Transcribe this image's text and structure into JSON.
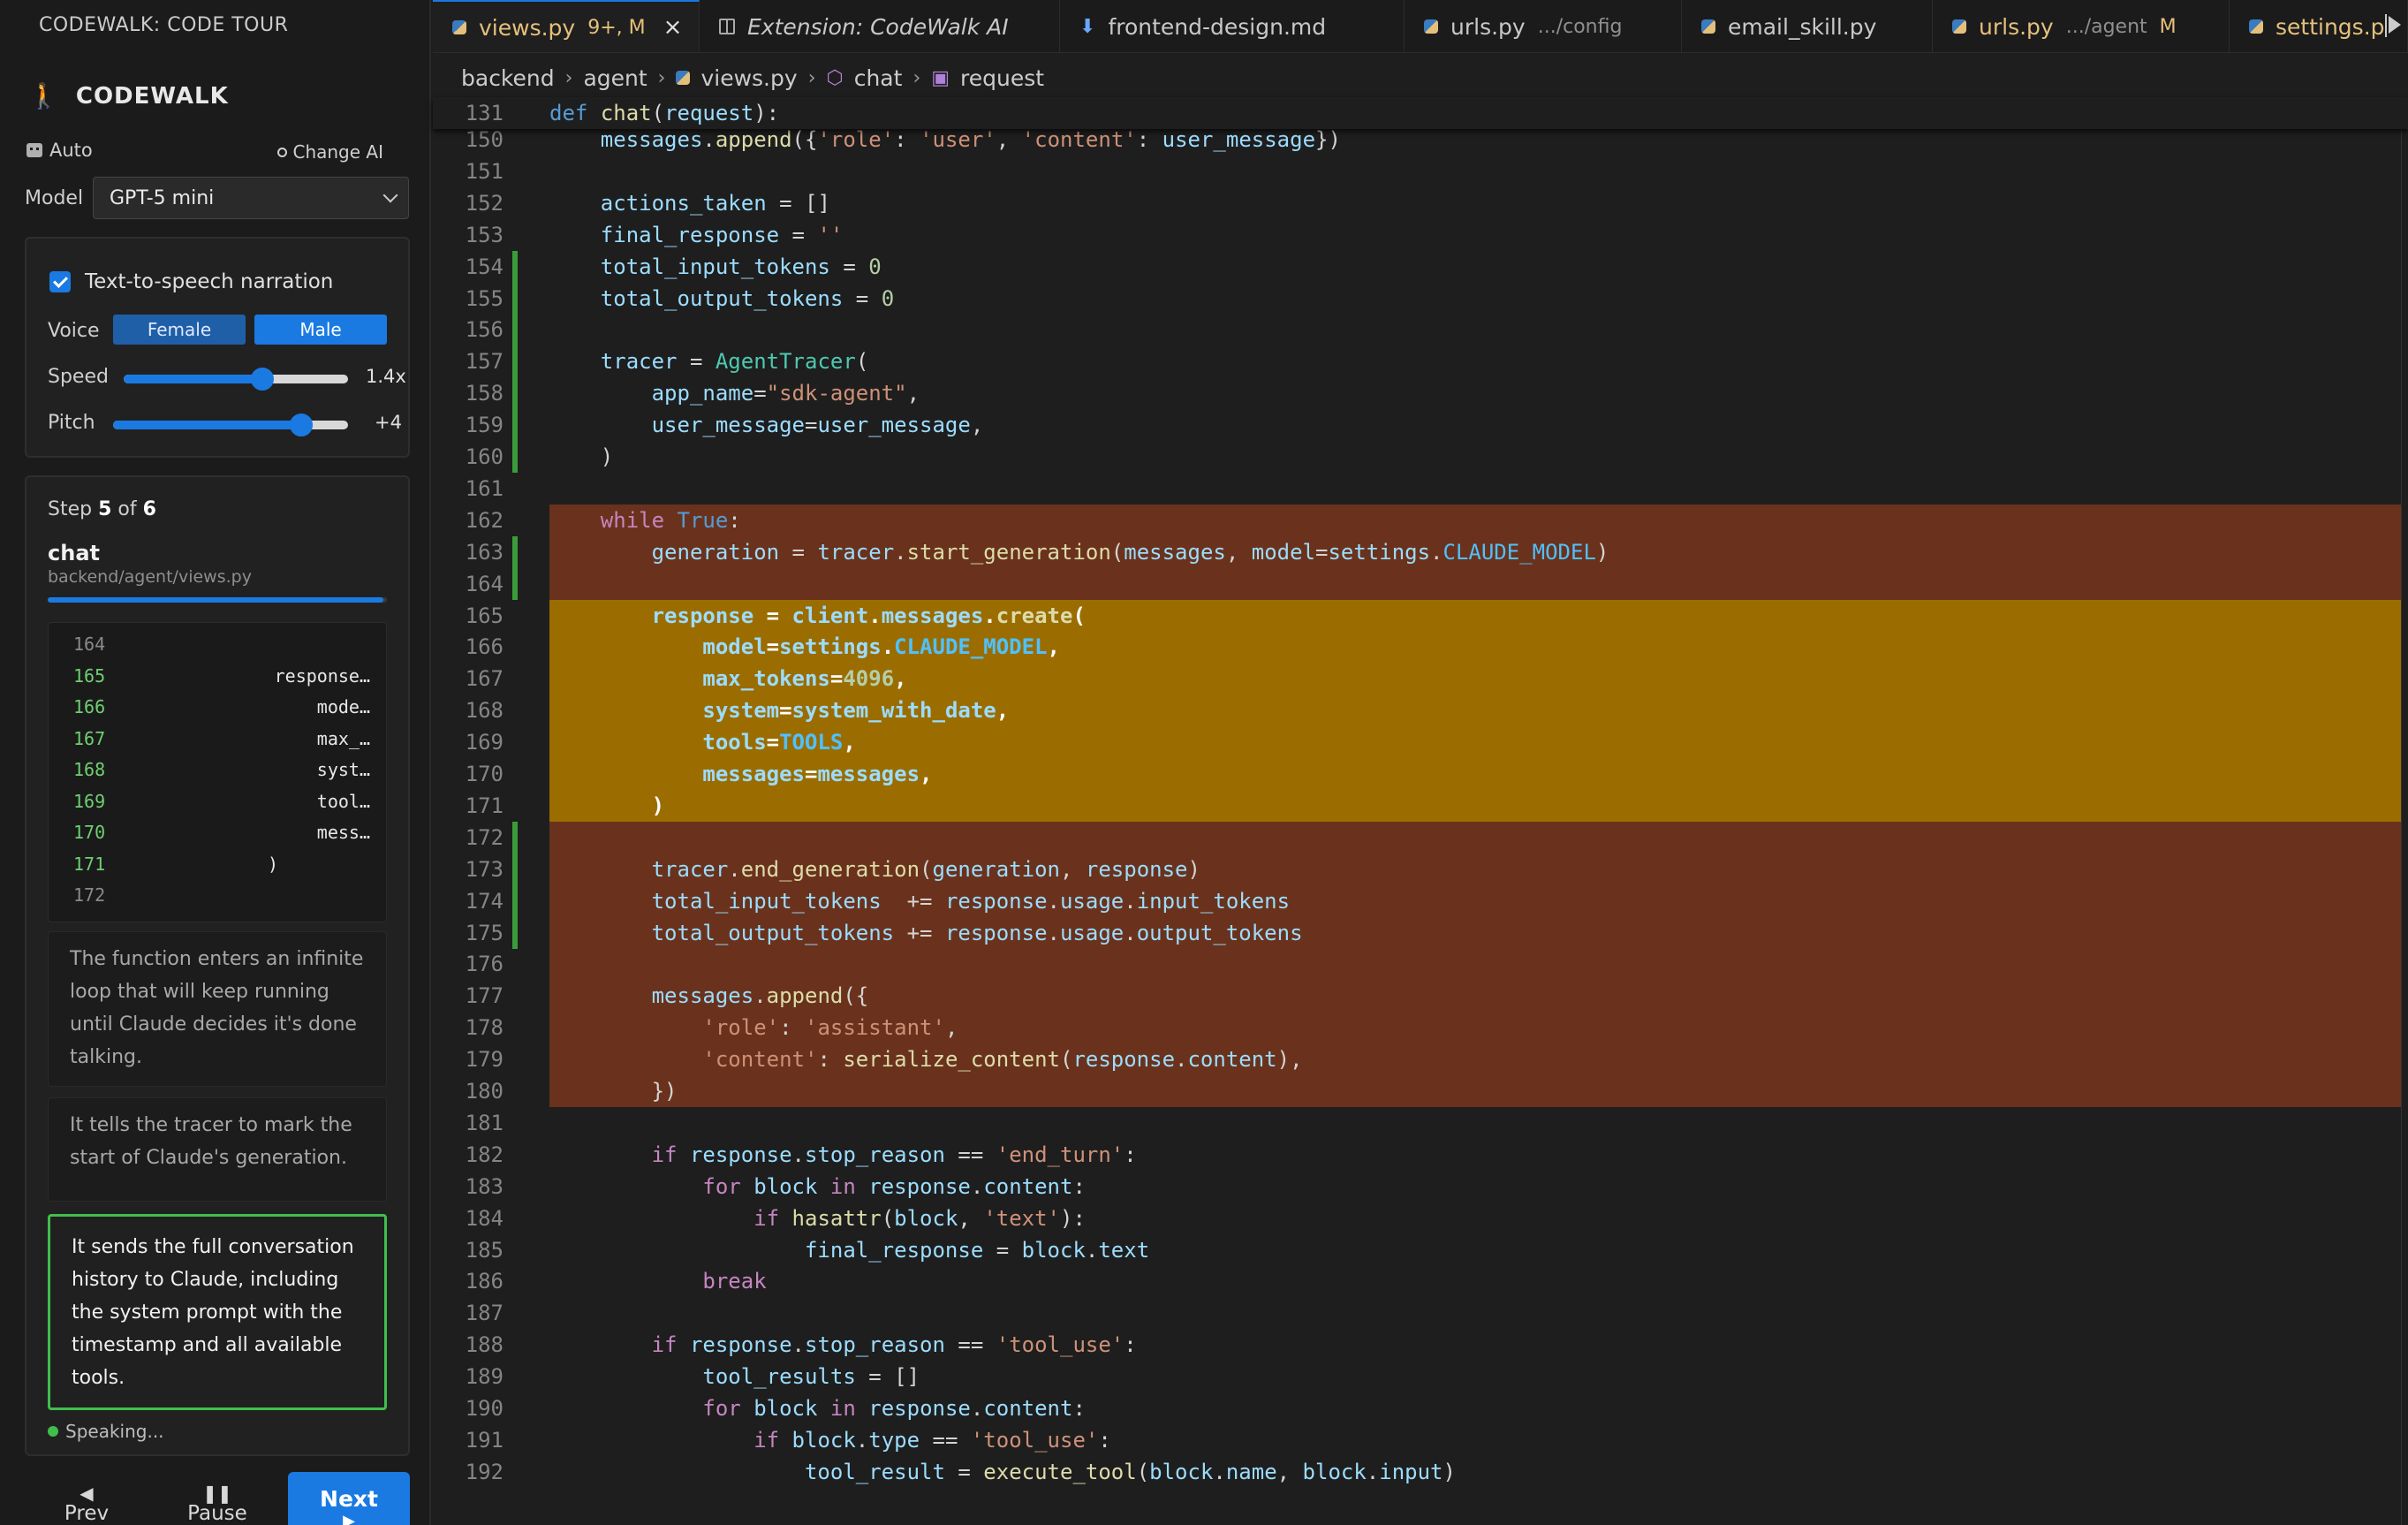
{
  "sidebar": {
    "title": "CODEWALK: CODE TOUR",
    "brand": "CODEWALK",
    "auto_label": "Auto",
    "change_ai_label": "Change AI",
    "model_label": "Model",
    "model_value": "GPT-5 mini",
    "tts_label": "Text-to-speech narration",
    "voice_label": "Voice",
    "voice_female": "Female",
    "voice_male": "Male",
    "speed_label": "Speed",
    "speed_value": "1.4x",
    "speed_fraction": 0.62,
    "pitch_label": "Pitch",
    "pitch_value": "+4",
    "pitch_fraction": 0.8,
    "step_prefix": "Step ",
    "step_current": "5",
    "step_of": " of ",
    "step_total": "6",
    "function_name": "chat",
    "file_path": "backend/agent/views.py",
    "progress_fraction": 0.99,
    "mini_lines": [
      {
        "num": "164",
        "text": ""
      },
      {
        "num": "165",
        "text": "response…"
      },
      {
        "num": "166",
        "text": "mode…"
      },
      {
        "num": "167",
        "text": "max_…"
      },
      {
        "num": "168",
        "text": "syst…"
      },
      {
        "num": "169",
        "text": "tool…"
      },
      {
        "num": "170",
        "text": "mess…"
      },
      {
        "num": "171",
        "text": ")"
      },
      {
        "num": "172",
        "text": ""
      }
    ],
    "narration_1": "The function enters an infinite loop that will keep running until Claude decides it's done talking.",
    "narration_2": "It tells the tracer to mark the start of Claude's generation.",
    "narration_3": "It sends the full conversation history to Claude, including the system prompt with the timestamp and all available tools.",
    "speaking": "Speaking...",
    "prev_label": "Prev",
    "pause_label": "Pause",
    "next_label": "Next"
  },
  "tabs": [
    {
      "label": "views.py",
      "meta": "9+, M",
      "active": true,
      "icon": "python-icon"
    },
    {
      "label": "Extension: CodeWalk AI",
      "meta": "",
      "active": false,
      "icon": "extension-icon"
    },
    {
      "label": "frontend-design.md",
      "meta": "",
      "active": false,
      "icon": "markdown-icon"
    },
    {
      "label": "urls.py",
      "meta": ".../config",
      "active": false,
      "icon": "python-icon"
    },
    {
      "label": "email_skill.py",
      "meta": "",
      "active": false,
      "icon": "python-icon"
    },
    {
      "label": "urls.py",
      "meta": ".../agent",
      "mod": "M",
      "active": false,
      "icon": "python-icon"
    },
    {
      "label": "settings.p",
      "meta": "",
      "active": false,
      "icon": "python-icon"
    }
  ],
  "breadcrumb": {
    "c1": "backend",
    "c2": "agent",
    "c3": "views.py",
    "c4": "chat",
    "c5": "request"
  },
  "editor": {
    "sticky_num": "131",
    "sticky_text": "def chat(request):",
    "lines": [
      {
        "n": "150",
        "t": "    messages.append({'role': 'user', 'content': user_message})",
        "hl": "",
        "mod": false
      },
      {
        "n": "151",
        "t": "",
        "hl": "",
        "mod": false
      },
      {
        "n": "152",
        "t": "    actions_taken = []",
        "hl": "",
        "mod": false
      },
      {
        "n": "153",
        "t": "    final_response = ''",
        "hl": "",
        "mod": false
      },
      {
        "n": "154",
        "t": "    total_input_tokens = 0",
        "hl": "",
        "mod": true
      },
      {
        "n": "155",
        "t": "    total_output_tokens = 0",
        "hl": "",
        "mod": true
      },
      {
        "n": "156",
        "t": "",
        "hl": "",
        "mod": true
      },
      {
        "n": "157",
        "t": "    tracer = AgentTracer(",
        "hl": "",
        "mod": true
      },
      {
        "n": "158",
        "t": "        app_name=\"sdk-agent\",",
        "hl": "",
        "mod": true
      },
      {
        "n": "159",
        "t": "        user_message=user_message,",
        "hl": "",
        "mod": true
      },
      {
        "n": "160",
        "t": "    )",
        "hl": "",
        "mod": true
      },
      {
        "n": "161",
        "t": "",
        "hl": "",
        "mod": false
      },
      {
        "n": "162",
        "t": "    while True:",
        "hl": "brown",
        "mod": false
      },
      {
        "n": "163",
        "t": "        generation = tracer.start_generation(messages, model=settings.CLAUDE_MODEL)",
        "hl": "brown",
        "mod": true
      },
      {
        "n": "164",
        "t": "",
        "hl": "brown",
        "mod": true
      },
      {
        "n": "165",
        "t": "        response = client.messages.create(",
        "hl": "yellow",
        "mod": false
      },
      {
        "n": "166",
        "t": "            model=settings.CLAUDE_MODEL,",
        "hl": "yellow",
        "mod": false
      },
      {
        "n": "167",
        "t": "            max_tokens=4096,",
        "hl": "yellow",
        "mod": false
      },
      {
        "n": "168",
        "t": "            system=system_with_date,",
        "hl": "yellow",
        "mod": false
      },
      {
        "n": "169",
        "t": "            tools=TOOLS,",
        "hl": "yellow",
        "mod": false
      },
      {
        "n": "170",
        "t": "            messages=messages,",
        "hl": "yellow",
        "mod": false
      },
      {
        "n": "171",
        "t": "        )",
        "hl": "yellow",
        "mod": false
      },
      {
        "n": "172",
        "t": "",
        "hl": "brown",
        "mod": true
      },
      {
        "n": "173",
        "t": "        tracer.end_generation(generation, response)",
        "hl": "brown",
        "mod": true
      },
      {
        "n": "174",
        "t": "        total_input_tokens  += response.usage.input_tokens",
        "hl": "brown",
        "mod": true
      },
      {
        "n": "175",
        "t": "        total_output_tokens += response.usage.output_tokens",
        "hl": "brown",
        "mod": true
      },
      {
        "n": "176",
        "t": "",
        "hl": "brown",
        "mod": false
      },
      {
        "n": "177",
        "t": "        messages.append({",
        "hl": "brown",
        "mod": false
      },
      {
        "n": "178",
        "t": "            'role': 'assistant',",
        "hl": "brown",
        "mod": false
      },
      {
        "n": "179",
        "t": "            'content': serialize_content(response.content),",
        "hl": "brown",
        "mod": false
      },
      {
        "n": "180",
        "t": "        })",
        "hl": "brown",
        "mod": false
      },
      {
        "n": "181",
        "t": "",
        "hl": "",
        "mod": false
      },
      {
        "n": "182",
        "t": "        if response.stop_reason == 'end_turn':",
        "hl": "",
        "mod": false
      },
      {
        "n": "183",
        "t": "            for block in response.content:",
        "hl": "",
        "mod": false
      },
      {
        "n": "184",
        "t": "                if hasattr(block, 'text'):",
        "hl": "",
        "mod": false
      },
      {
        "n": "185",
        "t": "                    final_response = block.text",
        "hl": "",
        "mod": false
      },
      {
        "n": "186",
        "t": "            break",
        "hl": "",
        "mod": false
      },
      {
        "n": "187",
        "t": "",
        "hl": "",
        "mod": false
      },
      {
        "n": "188",
        "t": "        if response.stop_reason == 'tool_use':",
        "hl": "",
        "mod": false
      },
      {
        "n": "189",
        "t": "            tool_results = []",
        "hl": "",
        "mod": false
      },
      {
        "n": "190",
        "t": "            for block in response.content:",
        "hl": "",
        "mod": false
      },
      {
        "n": "191",
        "t": "                if block.type == 'tool_use':",
        "hl": "",
        "mod": false
      },
      {
        "n": "192",
        "t": "                    tool_result = execute_tool(block.name, block.input)",
        "hl": "",
        "mod": false
      }
    ]
  },
  "colors": {
    "accent": "#1a7ae2",
    "highlight_current": "#9b6d00",
    "highlight_context": "#6a321c",
    "active_narration": "#3fbf4a"
  }
}
